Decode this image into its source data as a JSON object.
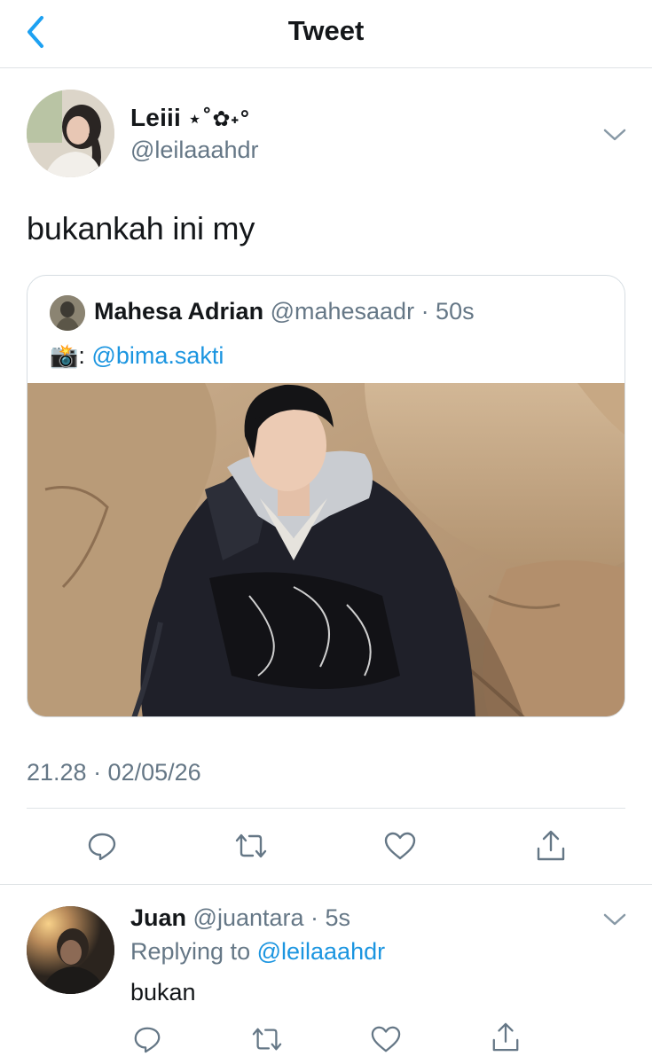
{
  "header": {
    "title": "Tweet"
  },
  "main_tweet": {
    "display_name": "Leiii",
    "name_decoration": "⋆˚✿˖°",
    "handle": "@leilaaahdr",
    "text": "bukankah ini my",
    "quoted_tweet": {
      "display_name": "Mahesa Adrian",
      "handle_time": "@mahesaadr · 50s",
      "camera_emoji": "📸",
      "colon": ":",
      "mention": "@bima.sakti"
    },
    "timestamp": "21.28 · 02/05/26"
  },
  "actions": [
    "reply-icon",
    "retweet-icon",
    "like-icon",
    "share-icon"
  ],
  "reply_tweet": {
    "display_name": "Juan",
    "handle_time": "@juantara · 5s",
    "replying_to_label": "Replying to",
    "replying_to_handle": "@leilaaahdr",
    "text": "bukan"
  },
  "colors": {
    "accent": "#1da1f2",
    "link": "#1b95e0",
    "secondary_text": "#657786",
    "primary_text": "#14171a",
    "divider": "#dfe3e6"
  }
}
